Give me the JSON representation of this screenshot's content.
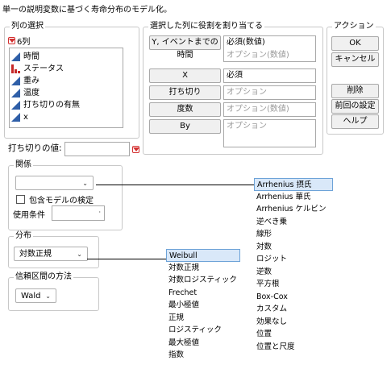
{
  "title": "単一の説明変数に基づく寿命分布のモデル化。",
  "column_select": {
    "label": "列の選択",
    "count": "6列",
    "columns": [
      {
        "name": "時間",
        "icon": "continuous-icon"
      },
      {
        "name": "ステータス",
        "icon": "nominal-icon"
      },
      {
        "name": "重み",
        "icon": "continuous-icon"
      },
      {
        "name": "温度",
        "icon": "continuous-icon"
      },
      {
        "name": "打ち切りの有無",
        "icon": "continuous-icon"
      },
      {
        "name": "x",
        "icon": "continuous-icon"
      }
    ]
  },
  "roles": {
    "label": "選択した列に役割を割り当てる",
    "y_button": "Y, イベントまでの時間",
    "y_value1": "必須(数値)",
    "y_value2": "オプション(数値)",
    "x_button": "X",
    "x_value": "必須",
    "censor_button": "打ち切り",
    "censor_value": "オプション",
    "freq_button": "度数",
    "freq_value": "オプション(数値)",
    "by_button": "By",
    "by_value": "オプション"
  },
  "actions": {
    "label": "アクション",
    "ok": "OK",
    "cancel": "キャンセル",
    "remove": "削除",
    "recall": "前回の設定",
    "help": "ヘルプ"
  },
  "censor_code": {
    "label": "打ち切りの値:",
    "value": ""
  },
  "relationship": {
    "label": "関係",
    "selected": "",
    "nested_check": "包含モデルの検定",
    "use_condition": "使用条件",
    "use_value": "",
    "options": [
      "Arrhenius 摂氏",
      "Arrhenius 華氏",
      "Arrhenius ケルビン",
      "逆べき乗",
      "線形",
      "対数",
      "ロジット",
      "逆数",
      "平方根",
      "Box-Cox",
      "カスタム",
      "効果なし",
      "位置",
      "位置と尺度"
    ],
    "highlighted": "Arrhenius 摂氏"
  },
  "distribution": {
    "label": "分布",
    "selected": "対数正規",
    "options": [
      "Weibull",
      "対数正規",
      "対数ロジスティック",
      "Frechet",
      "最小極値",
      "正規",
      "ロジスティック",
      "最大極値",
      "指数"
    ],
    "highlighted": "Weibull"
  },
  "ci_method": {
    "label": "信頼区間の方法",
    "selected": "Wald"
  },
  "colors": {
    "accent": "#2f5fa8",
    "red": "#d32f2f",
    "highlight": "#d9e8f9"
  }
}
